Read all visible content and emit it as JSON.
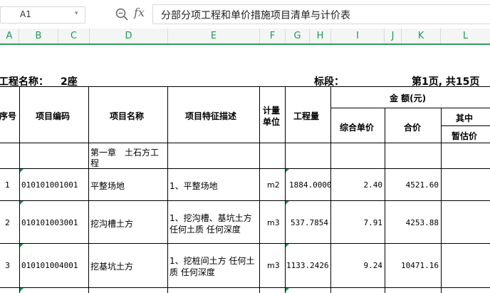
{
  "formula_bar": {
    "cell_ref": "A1",
    "formula": "分部分项工程和单价措施项目清单与计价表"
  },
  "columns": [
    "A",
    "B",
    "C",
    "D",
    "E",
    "F",
    "G",
    "H",
    "I",
    "J",
    "K",
    "L"
  ],
  "sheet": {
    "project_label": "工程名称：",
    "project_value": "2座",
    "section_label": "标段：",
    "page_info": "第1页, 共15页",
    "headers": {
      "seq": "序号",
      "code": "项目编码",
      "name": "项目名称",
      "feature": "项目特征描述",
      "unit_line1": "计量",
      "unit_line2": "单位",
      "qty": "工程量",
      "amount": "金 额(元)",
      "unit_price": "综合单价",
      "total": "合价",
      "of_which": "其中",
      "provisional": "暂估价"
    },
    "chapter": {
      "line1": "第一章　土石方工",
      "line2": "程"
    },
    "rows": [
      {
        "seq": "1",
        "code": "010101001001",
        "name": "平整场地",
        "feature_line1": "1、平整场地",
        "feature_line2": "",
        "unit": "m2",
        "qty": "1884.0000",
        "unit_price": "2.40",
        "total": "4521.60"
      },
      {
        "seq": "2",
        "code": "010101003001",
        "name": "挖沟槽土方",
        "feature_line1": "1、挖沟槽、基坑土方",
        "feature_line2": "任何土质 任何深度",
        "unit": "m3",
        "qty": "537.7854",
        "unit_price": "7.91",
        "total": "4253.88"
      },
      {
        "seq": "3",
        "code": "010101004001",
        "name": "挖基坑土方",
        "feature_line1": "1、挖桩间土方 任何土",
        "feature_line2": "质 任何深度",
        "unit": "m3",
        "qty": "1133.2426",
        "unit_price": "9.24",
        "total": "10471.16"
      }
    ]
  }
}
